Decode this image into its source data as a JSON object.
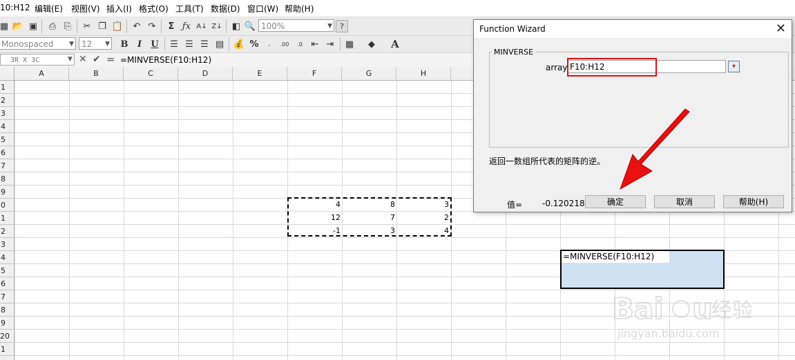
{
  "menubar": {
    "title_fragment": "10:H12",
    "items": [
      "编辑(E)",
      "视图(V)",
      "插入(I)",
      "格式(O)",
      "工具(T)",
      "数据(D)",
      "窗口(W)",
      "帮助(H)"
    ]
  },
  "toolbar": {
    "zoom": "100%",
    "font_name": "Monospaced",
    "font_size": "12",
    "bold": "B",
    "italic": "I",
    "underline": "U",
    "percent": "%"
  },
  "formula_bar": {
    "name_box": "3R X 3C",
    "formula": "=MINVERSE(F10:H12)"
  },
  "columns": [
    "A",
    "B",
    "C",
    "D",
    "E",
    "F",
    "G",
    "H"
  ],
  "rows": [
    "1",
    "2",
    "3",
    "4",
    "5",
    "6",
    "7",
    "8",
    "9",
    "0",
    "1",
    "2",
    "3",
    "4",
    "5",
    "6",
    "7",
    "8",
    "9",
    "20",
    "1"
  ],
  "cells": [
    [
      "4",
      "8",
      "3"
    ],
    [
      "12",
      "7",
      "2"
    ],
    [
      "-1",
      "3",
      "4"
    ]
  ],
  "active_cell_text": "=MINVERSE(F10:H12)",
  "dialog": {
    "title": "Function Wizard",
    "function_name": "MINVERSE",
    "arg_label": "array",
    "arg_value": "F10:H12",
    "description": "返回一数组所代表的矩阵的逆。",
    "value_label": "值=",
    "value": "-0.1202185",
    "ok_label": "确定",
    "cancel_label": "取消",
    "help_label": "帮助(H)"
  },
  "watermark": {
    "url": "jingyan.baidu.com"
  },
  "colors": {
    "annotation_red": "#e01010",
    "selection_blue": "#cfe2f4"
  }
}
